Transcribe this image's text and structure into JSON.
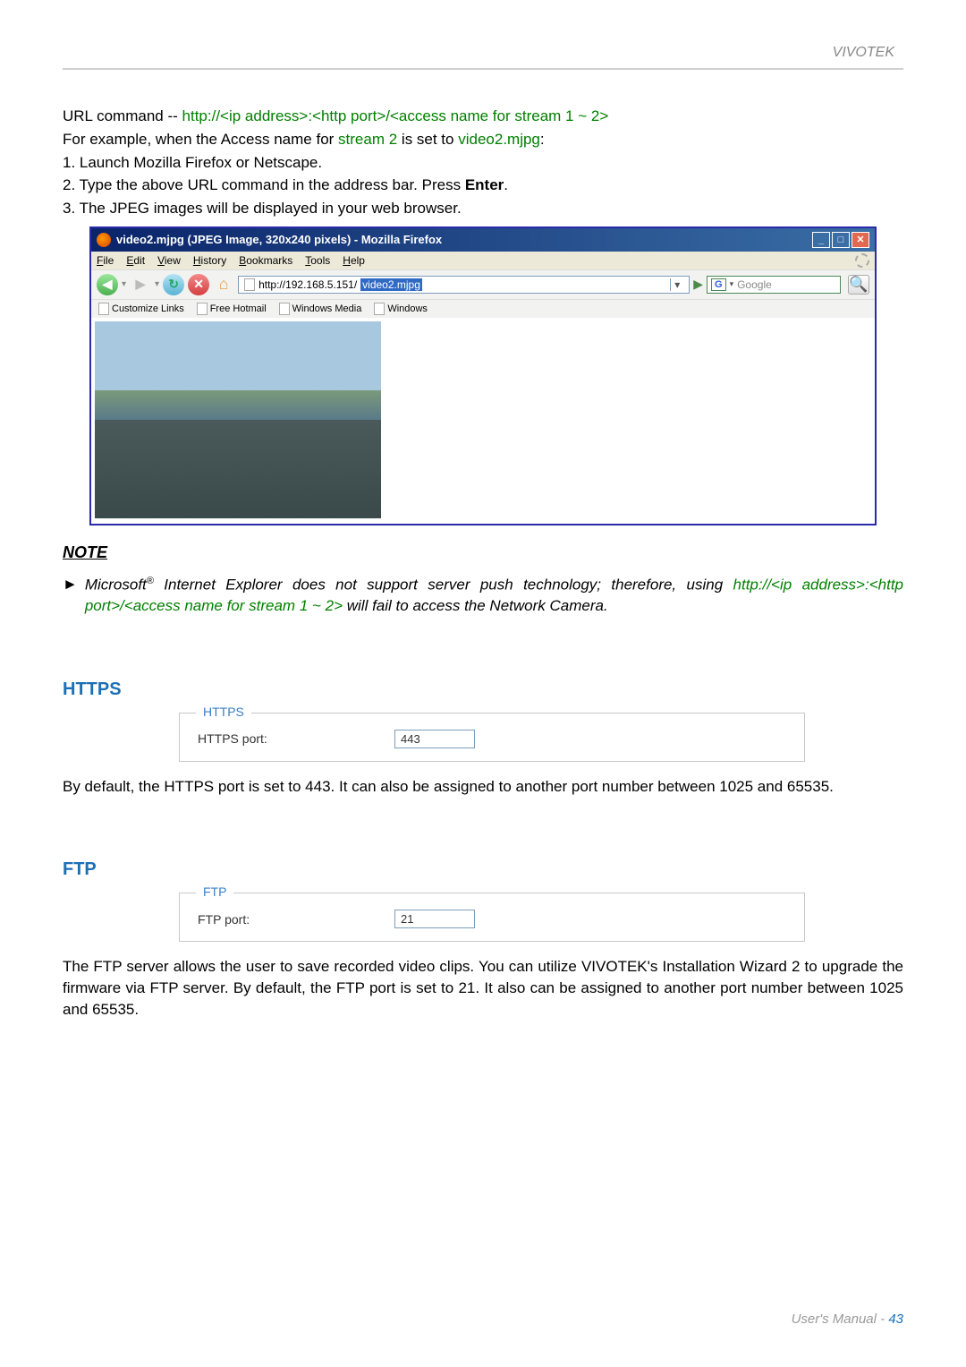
{
  "header": {
    "brand": "VIVOTEK"
  },
  "urlcmd": {
    "prefix": "URL command -- ",
    "pattern": "http://<ip address>:<http port>/<access name for stream 1 ~ 2>",
    "eg1a": "For example, when the Access name for ",
    "eg1b": "stream 2",
    "eg1c": " is set to ",
    "eg1d": "video2.mjpg",
    "eg1e": ":",
    "step1": "1. Launch Mozilla Firefox or Netscape.",
    "step2a": "2. Type the above URL command in the address bar. Press ",
    "step2b": "Enter",
    "step2c": ".",
    "step3": "3. The JPEG images will be displayed in your web browser."
  },
  "firefox": {
    "title": "video2.mjpg (JPEG Image, 320x240 pixels) - Mozilla Firefox",
    "menu": [
      "File",
      "Edit",
      "View",
      "History",
      "Bookmarks",
      "Tools",
      "Help"
    ],
    "url_prefix": "http://192.168.5.151/",
    "url_highlight": "video2.mjpg",
    "search_placeholder": "Google",
    "bookmarks": [
      "Customize Links",
      "Free Hotmail",
      "Windows Media",
      "Windows"
    ]
  },
  "note": {
    "heading": "NOTE",
    "t1": "Microsoft",
    "t1sup": "®",
    "t2": " Internet Explorer does not support server push technology; therefore, using ",
    "t3": "http://<ip address>:<http port>/<access name for stream 1 ~ 2>",
    "t4": " will fail to access the Network Camera."
  },
  "https": {
    "title": "HTTPS",
    "legend": "HTTPS",
    "label": "HTTPS port:",
    "value": "443",
    "desc": "By default, the HTTPS port is set to 443. It can also be assigned to another port number between 1025 and 65535."
  },
  "ftp": {
    "title": "FTP",
    "legend": "FTP",
    "label": "FTP port:",
    "value": "21",
    "desc": "The FTP server allows the user to save recorded video clips. You can utilize VIVOTEK's Installation Wizard 2 to upgrade the firmware via FTP server. By default, the FTP port is set to 21. It also can be assigned to another port number between 1025 and 65535."
  },
  "footer": {
    "label": "User's Manual - ",
    "page": "43"
  }
}
